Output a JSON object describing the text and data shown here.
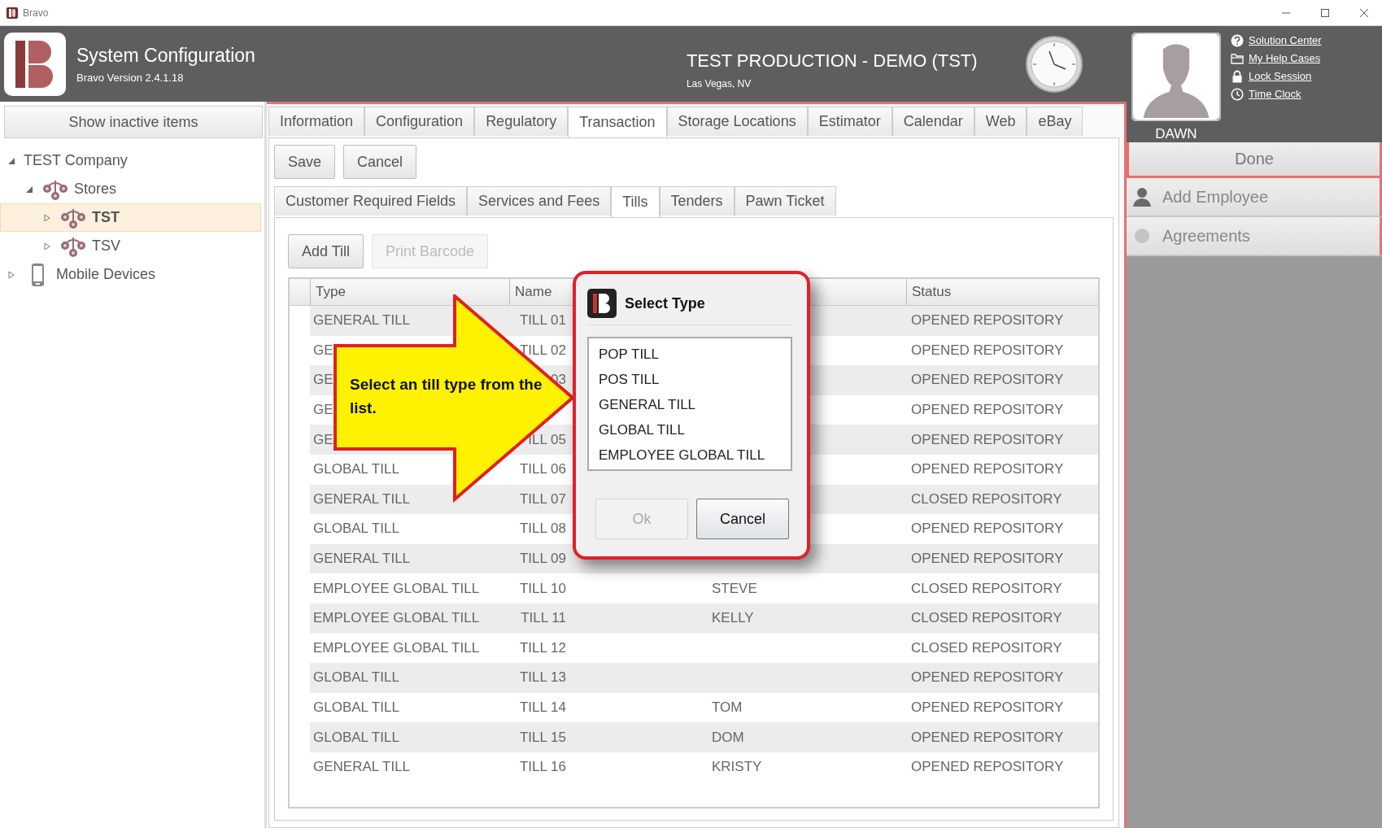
{
  "window": {
    "title": "Bravo"
  },
  "header": {
    "title": "System Configuration",
    "version": "Bravo Version 2.4.1.18",
    "environment": "TEST PRODUCTION - DEMO (TST)",
    "location": "Las Vegas, NV"
  },
  "user": {
    "name": "DAWN",
    "links": [
      {
        "kind": "help",
        "label": "Solution Center"
      },
      {
        "kind": "folder",
        "label": "My Help Cases"
      },
      {
        "kind": "lock",
        "label": "Lock Session"
      },
      {
        "kind": "clock",
        "label": "Time Clock"
      }
    ]
  },
  "side_menu": {
    "done": "Done",
    "items": [
      {
        "kind": "employee",
        "label": "Add Employee"
      },
      {
        "kind": "dot",
        "label": "Agreements"
      }
    ]
  },
  "sidebar": {
    "show_inactive": "Show inactive items",
    "tree": [
      {
        "label": "TEST Company",
        "kind": "company",
        "expanded": true,
        "selected": false,
        "children": [
          {
            "label": "Stores",
            "kind": "store",
            "expanded": true,
            "selected": false,
            "children": [
              {
                "label": "TST",
                "kind": "store",
                "expanded": false,
                "selected": true
              },
              {
                "label": "TSV",
                "kind": "store",
                "expanded": false,
                "selected": false
              }
            ]
          }
        ]
      },
      {
        "label": "Mobile Devices",
        "kind": "device",
        "expanded": false,
        "selected": false
      }
    ]
  },
  "tabs": [
    {
      "label": "Information",
      "selected": false
    },
    {
      "label": "Configuration",
      "selected": false
    },
    {
      "label": "Regulatory",
      "selected": false
    },
    {
      "label": "Transaction",
      "selected": true
    },
    {
      "label": "Storage Locations",
      "selected": false
    },
    {
      "label": "Estimator",
      "selected": false
    },
    {
      "label": "Calendar",
      "selected": false
    },
    {
      "label": "Web",
      "selected": false
    },
    {
      "label": "eBay",
      "selected": false
    }
  ],
  "actions": [
    "Save",
    "Cancel"
  ],
  "subtabs": [
    {
      "label": "Customer Required Fields",
      "selected": false
    },
    {
      "label": "Services and Fees",
      "selected": false
    },
    {
      "label": "Tills",
      "selected": true
    },
    {
      "label": "Tenders",
      "selected": false
    },
    {
      "label": "Pawn Ticket",
      "selected": false
    }
  ],
  "tills": {
    "buttons": [
      {
        "label": "Add Till",
        "disabled": false
      },
      {
        "label": "Print Barcode",
        "disabled": true
      }
    ],
    "table": {
      "columns": [
        "Type",
        "Name",
        "Status"
      ],
      "rows": [
        {
          "type": "GENERAL TILL",
          "name": "TILL 01",
          "status": "OPENED REPOSITORY"
        },
        {
          "type": "GE",
          "name": "TILL 02",
          "status": "OPENED REPOSITORY"
        },
        {
          "type": "GE",
          "name": "03",
          "status": "OPENED REPOSITORY"
        },
        {
          "type": "GE",
          "status": "OPENED REPOSITORY"
        },
        {
          "type": "GE",
          "name": "ILL 05",
          "status": "OPENED REPOSITORY"
        },
        {
          "type": "GLOBAL TILL",
          "name": "TILL 06",
          "status": "OPENED REPOSITORY"
        },
        {
          "type": "GENERAL TILL",
          "name": "TILL 07",
          "status": "CLOSED REPOSITORY"
        },
        {
          "type": "GLOBAL TILL",
          "name": "TILL 08",
          "status": "OPENED REPOSITORY"
        },
        {
          "type": "GENERAL TILL",
          "name": "TILL 09",
          "status": "OPENED REPOSITORY"
        },
        {
          "type": "EMPLOYEE GLOBAL TILL",
          "name": "TILL 10",
          "column_3": "STEVE",
          "status": "CLOSED REPOSITORY"
        },
        {
          "type": "EMPLOYEE GLOBAL TILL",
          "name": "TILL 11",
          "column_3": "KELLY",
          "status": "CLOSED REPOSITORY"
        },
        {
          "type": "EMPLOYEE GLOBAL TILL",
          "name": "TILL 12",
          "status": "CLOSED REPOSITORY"
        },
        {
          "type": "GLOBAL TILL",
          "name": "TILL 13",
          "status": "OPENED REPOSITORY"
        },
        {
          "type": "GLOBAL TILL",
          "name": "TILL 14",
          "column_3": "TOM",
          "status": "OPENED REPOSITORY"
        },
        {
          "type": "GLOBAL TILL",
          "name": "TILL 15",
          "column_3": "DOM",
          "status": "OPENED REPOSITORY"
        },
        {
          "type": "GENERAL TILL",
          "name": "TILL 16",
          "column_3": "KRISTY",
          "status": "OPENED REPOSITORY"
        }
      ]
    }
  },
  "dialog": {
    "title": "Select Type",
    "options": [
      {
        "label": "POP TILL",
        "selected": false
      },
      {
        "label": "POS TILL",
        "selected": false
      },
      {
        "label": "GENERAL TILL",
        "selected": false
      },
      {
        "label": "GLOBAL TILL",
        "selected": false
      },
      {
        "label": "EMPLOYEE GLOBAL TILL",
        "selected": false
      }
    ],
    "buttons": [
      {
        "label": "Ok",
        "disabled": true
      },
      {
        "label": "Cancel",
        "disabled": false
      }
    ]
  },
  "callout": {
    "text": "Select an till type from the list."
  }
}
